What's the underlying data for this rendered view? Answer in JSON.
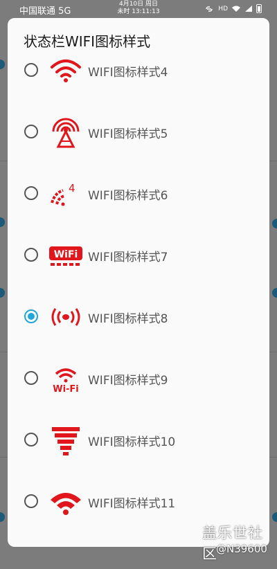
{
  "status_bar": {
    "carrier": "中国联通 5G",
    "date": "4月10日 周日",
    "time": "未时 13:11:13",
    "hd": "HD"
  },
  "dialog": {
    "title": "状态栏WIFI图标样式",
    "options": [
      {
        "label": "WIFI图标样式4",
        "icon": "wifi-style-4-icon",
        "checked": false
      },
      {
        "label": "WIFI图标样式5",
        "icon": "wifi-style-5-icon",
        "checked": false
      },
      {
        "label": "WIFI图标样式6",
        "icon": "wifi-style-6-icon",
        "checked": false
      },
      {
        "label": "WIFI图标样式7",
        "icon": "wifi-style-7-icon",
        "checked": false
      },
      {
        "label": "WIFI图标样式8",
        "icon": "wifi-style-8-icon",
        "checked": true
      },
      {
        "label": "WIFI图标样式9",
        "icon": "wifi-style-9-icon",
        "checked": false
      },
      {
        "label": "WIFI图标样式10",
        "icon": "wifi-style-10-icon",
        "checked": false
      },
      {
        "label": "WIFI图标样式11",
        "icon": "wifi-style-11-icon",
        "checked": false
      }
    ]
  },
  "watermark": {
    "site": "盖乐世社区",
    "user": "@N39600"
  },
  "colors": {
    "accent": "#1ea7d8",
    "icon_red": "#e0161c",
    "dim_overlay": "#7c7c7c"
  }
}
